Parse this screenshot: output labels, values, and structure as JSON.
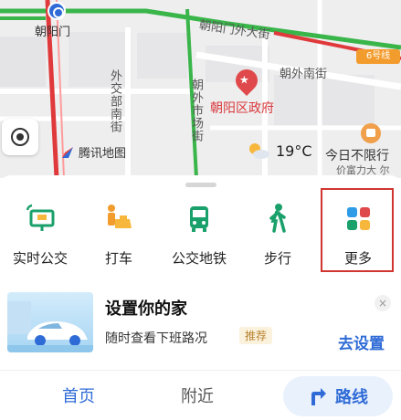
{
  "map": {
    "station_label": "朝阳门",
    "road_east_outer": "朝阳门外大街",
    "road_south": "朝外南街",
    "road_waijiao": "外交部南街",
    "road_chaowai_market": "朝外市场街",
    "landmark": "朝阳区政府",
    "road_badge": "6号线",
    "brand": "腾讯地图",
    "temperature": "19°C",
    "notice_line": "今日不限行",
    "notice_line2": "价富力大 尔",
    "icons": {
      "metro": "metro-station-icon",
      "pin": "landmark-pin-icon",
      "locate": "locate-icon",
      "brand": "tencent-map-logo-icon",
      "weather": "weather-sun-cloud-icon",
      "shop": "shopping-bag-icon"
    }
  },
  "quick_actions": [
    {
      "label": "实时公交",
      "icon": "realtime-bus-icon"
    },
    {
      "label": "打车",
      "icon": "taxi-icon"
    },
    {
      "label": "公交地铁",
      "icon": "metro-icon"
    },
    {
      "label": "步行",
      "icon": "walk-icon"
    },
    {
      "label": "更多",
      "icon": "more-grid-icon"
    }
  ],
  "banner": {
    "title": "设置你的家",
    "subtitle": "随时查看下班路况",
    "tag": "推荐",
    "action": "去设置",
    "close": "×"
  },
  "tabbar": {
    "home": "首页",
    "nearby": "附近",
    "route": "路线"
  },
  "colors": {
    "accent": "#2f6bd6",
    "highlight_border": "#d0352f",
    "map_bg": "#eeeeef",
    "road_green": "#39b54a",
    "road_red": "#e0393b"
  }
}
